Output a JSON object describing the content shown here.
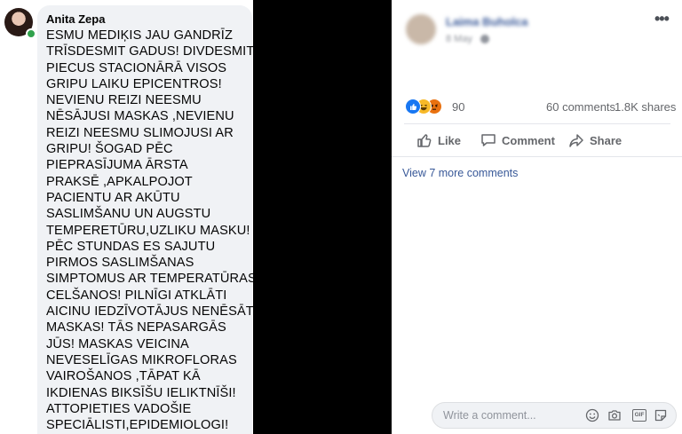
{
  "comment": {
    "author": "Anita Zepa",
    "lines": [
      "ESMU MEDIĶIS JAU  GANDRĪZ",
      "TRĪSDESMIT GADUS! DIVDESMIT",
      "PIECUS STACIONĀRĀ VISOS",
      "GRIPU LAIKU EPICENTROS!",
      "NEVIENU REIZI NEESMU",
      "NĒSĀJUSI MASKAS ,NEVIENU",
      "REIZI NEESMU SLIMOJUSI AR",
      "GRIPU! ŠOGAD PĒC",
      "PIEPRASĪJUMA ĀRSTA",
      "PRAKSĒ ,APKALPOJOT",
      "PACIENTU AR AKŪTU",
      "SASLIMŠANU UN AUGSTU",
      "TEMPERETŪRU,UZLIKU MASKU!",
      "PĒC STUNDAS ES SAJUTU",
      "PIRMOS SASLIMŠANAS",
      "SIMPTOMUS AR TEMPERATŪRAS",
      "CELŠANOS! PILNĪGI ATKLĀTI",
      "AICINU IEDZĪVOTĀJUS NENĒSĀT",
      "MASKAS! TĀS NEPASARGĀS",
      "JŪS! MASKAS VEICINA",
      "NEVESELĪGAS MIKROFLORAS",
      "VAIROŠANOS ,TĀPAT KĀ",
      "IKDIENAS BIKSĪŠU IELIKTNĪŠI!",
      "ATTOPIETIES VADOŠIE",
      "SPECIĀLISTI,EPIDEMIOLOGI!"
    ]
  },
  "post": {
    "author": "Laima Buholca",
    "date": "8 May",
    "more_icon": "•••",
    "reactions": [
      "like-icon",
      "haha-icon",
      "angry-icon"
    ],
    "reaction_count": "90",
    "comments_count": "60 comments",
    "shares_count": "1.8K shares",
    "actions": {
      "like": "Like",
      "comment": "Comment",
      "share": "Share"
    },
    "view_more_comments": "View 7 more comments",
    "comment_placeholder": "Write a comment...",
    "gif_label": "GIF"
  },
  "colors": {
    "link": "#385898",
    "like_blue": "#1877f2",
    "haha_yellow": "#f7b928",
    "angry_orange": "#e9710f",
    "bubble": "#f0f2f5"
  }
}
